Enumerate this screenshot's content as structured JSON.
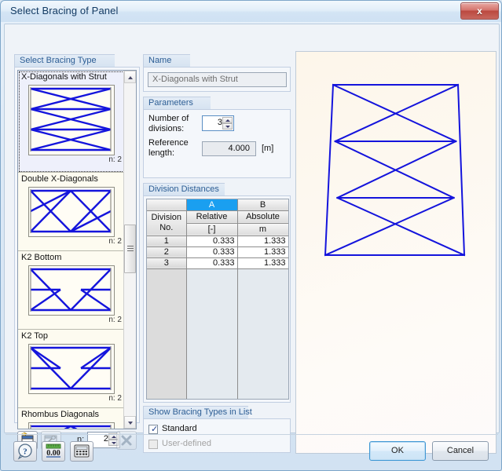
{
  "window": {
    "title": "Select Bracing of Panel",
    "close_label": "x"
  },
  "bracing_list": {
    "group_title": "Select Bracing Type",
    "items": [
      {
        "name": "X-Diagonals with Strut",
        "count_label": "n: 2",
        "selected": true,
        "figure": "x-diagonals-with-strut"
      },
      {
        "name": "Double X-Diagonals",
        "count_label": "n: 2",
        "selected": false,
        "figure": "double-x-diagonals"
      },
      {
        "name": "K2 Bottom",
        "count_label": "n: 2",
        "selected": false,
        "figure": "k2-bottom"
      },
      {
        "name": "K2 Top",
        "count_label": "n: 2",
        "selected": false,
        "figure": "k2-top"
      },
      {
        "name": "Rhombus Diagonals",
        "count_label": "",
        "selected": false,
        "figure": "rhombus-diagonals"
      }
    ],
    "toolbar": {
      "new_label": "new-bracing-type",
      "edit_label": "edit-bracing-type",
      "n_label": "n:",
      "n_value": "2",
      "delete_label": "delete-bracing-type"
    }
  },
  "name_group": {
    "group_title": "Name",
    "value": "X-Diagonals with Strut"
  },
  "parameters": {
    "group_title": "Parameters",
    "divisions_label": "Number of divisions:",
    "divisions_value": "3",
    "reference_label": "Reference length:",
    "reference_value": "4.000",
    "reference_unit": "[m]"
  },
  "division_distances": {
    "group_title": "Division Distances",
    "col_letters": [
      "",
      "A",
      "B"
    ],
    "col_titles": [
      "Division No.",
      "Relative",
      "Absolute"
    ],
    "col_units": [
      "",
      "[-]",
      "m"
    ],
    "rows": [
      {
        "no": "1",
        "relative": "0.333",
        "absolute": "1.333"
      },
      {
        "no": "2",
        "relative": "0.333",
        "absolute": "1.333"
      },
      {
        "no": "3",
        "relative": "0.333",
        "absolute": "1.333"
      }
    ],
    "accent_color": "#1a9ff0"
  },
  "show_types": {
    "group_title": "Show Bracing Types in List",
    "options": [
      {
        "label": "Standard",
        "checked": true,
        "disabled": false,
        "tick": "✓"
      },
      {
        "label": "User-defined",
        "checked": false,
        "disabled": true,
        "tick": ""
      }
    ]
  },
  "preview": {
    "name": "bracing-preview",
    "line_color": "#1414dc",
    "divisions": 3,
    "shape": "trapezoid",
    "pattern": "x-diagonals-with-strut"
  },
  "bottom_bar": {
    "help_label": "?",
    "units_label": "0.00",
    "calculator_label": "calculator",
    "ok_label": "OK",
    "cancel_label": "Cancel"
  }
}
